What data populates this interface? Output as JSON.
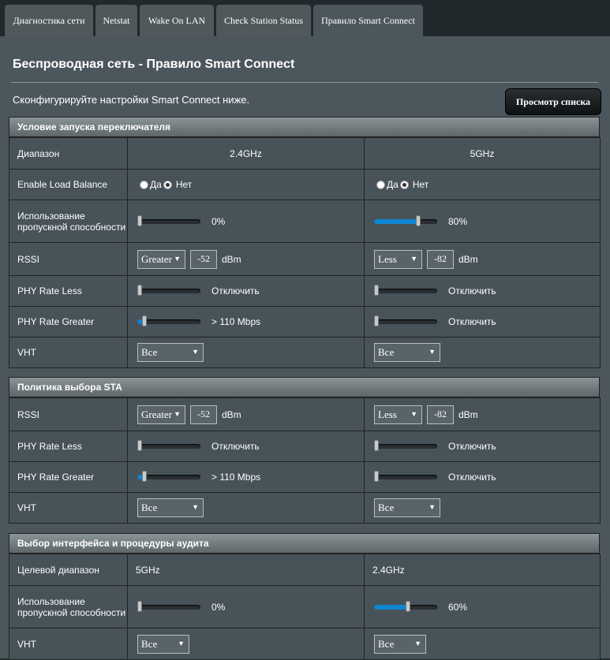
{
  "tabs": [
    {
      "label": "Диагностика сети"
    },
    {
      "label": "Netstat"
    },
    {
      "label": "Wake On LAN"
    },
    {
      "label": "Check Station Status"
    },
    {
      "label": "Правило Smart Connect"
    }
  ],
  "page": {
    "title": "Беспроводная сеть - Правило Smart Connect",
    "description": "Сконфигурируйте настройки Smart Connect ниже.",
    "list_button": "Просмотр списка"
  },
  "sections": {
    "trigger": {
      "title": "Условие запуска переключателя",
      "band_label": "Диапазон",
      "band_24": "2.4GHz",
      "band_5": "5GHz",
      "load_balance_label": "Enable Load Balance",
      "yes": "Да",
      "no": "Нет",
      "lb_24": "Нет",
      "lb_5": "Нет",
      "bw_label": "Использование пропускной способности",
      "bw_24": "0%",
      "bw_5": "80%",
      "bw_24_value": 0,
      "bw_5_value": 0.8,
      "rssi_label": "RSSI",
      "rssi_24_cond": "Greater",
      "rssi_24_val": "-52",
      "rssi_5_cond": "Less",
      "rssi_5_val": "-82",
      "unit": "dBm",
      "phy_less_label": "PHY Rate Less",
      "phy_less_24": "Отключить",
      "phy_less_5": "Отключить",
      "phy_greater_label": "PHY Rate Greater",
      "phy_greater_24": "> 110 Mbps",
      "phy_greater_5": "Отключить",
      "vht_label": "VHT",
      "vht_24": "Все",
      "vht_5": "Все"
    },
    "sta": {
      "title": "Политика выбора STA",
      "rssi_label": "RSSI",
      "rssi_24_cond": "Greater",
      "rssi_24_val": "-52",
      "rssi_5_cond": "Less",
      "rssi_5_val": "-82",
      "unit": "dBm",
      "phy_less_label": "PHY Rate Less",
      "phy_less_24": "Отключить",
      "phy_less_5": "Отключить",
      "phy_greater_label": "PHY Rate Greater",
      "phy_greater_24": "> 110 Mbps",
      "phy_greater_5": "Отключить",
      "vht_label": "VHT",
      "vht_24": "Все",
      "vht_5": "Все"
    },
    "iface": {
      "title": "Выбор интерфейса и процедуры аудита",
      "target_label": "Целевой диапазон",
      "target_24": "5GHz",
      "target_5": "2.4GHz",
      "bw_label": "Использование пропускной способности",
      "bw_24": "0%",
      "bw_5": "60%",
      "bw_24_value": 0,
      "bw_5_value": 0.6,
      "vht_label": "VHT",
      "vht_24": "Все",
      "vht_5": "Все"
    }
  },
  "colors": {
    "panel": "#4c575d",
    "cell": "#475359",
    "accent": "#0f86d2",
    "tabs_bg": "#22292c"
  }
}
